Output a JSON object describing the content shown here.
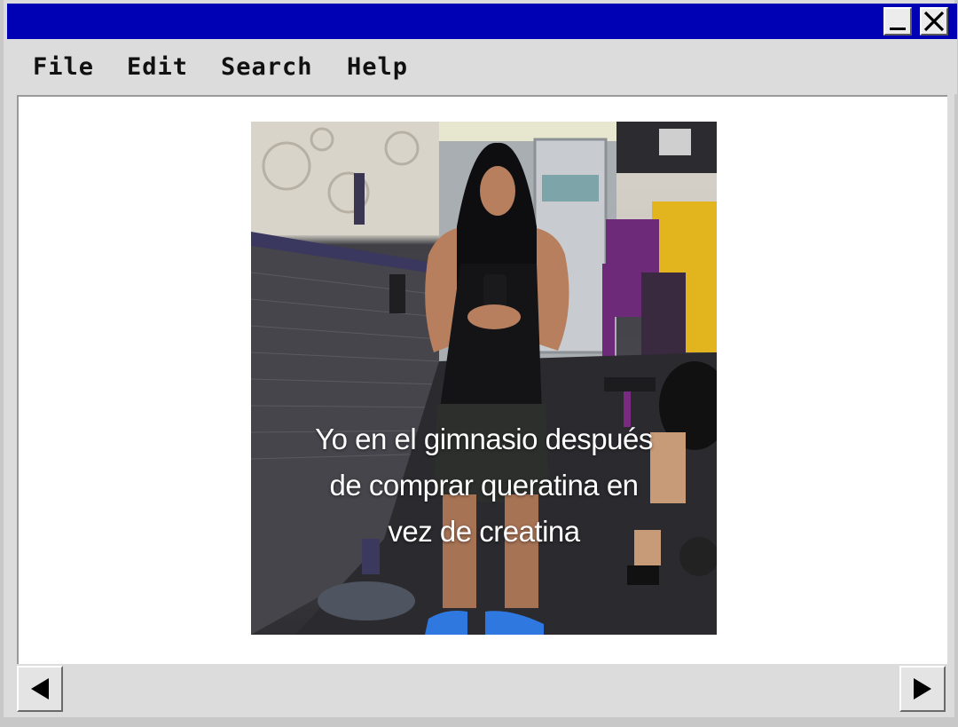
{
  "window": {
    "controls": {
      "minimize_icon": "minimize-icon",
      "close_icon": "close-icon"
    }
  },
  "menu": {
    "items": [
      {
        "label": "File"
      },
      {
        "label": "Edit"
      },
      {
        "label": "Search"
      },
      {
        "label": "Help"
      }
    ]
  },
  "image": {
    "caption_lines": [
      "Yo en el gimnasio después",
      "de comprar queratina en",
      "vez de creatina"
    ]
  },
  "scrollbar": {
    "left_icon": "arrow-left-icon",
    "right_icon": "arrow-right-icon"
  },
  "colors": {
    "titlebar": "#0000b4",
    "window_bg": "#dcdcdc",
    "content_bg": "#ffffff"
  }
}
